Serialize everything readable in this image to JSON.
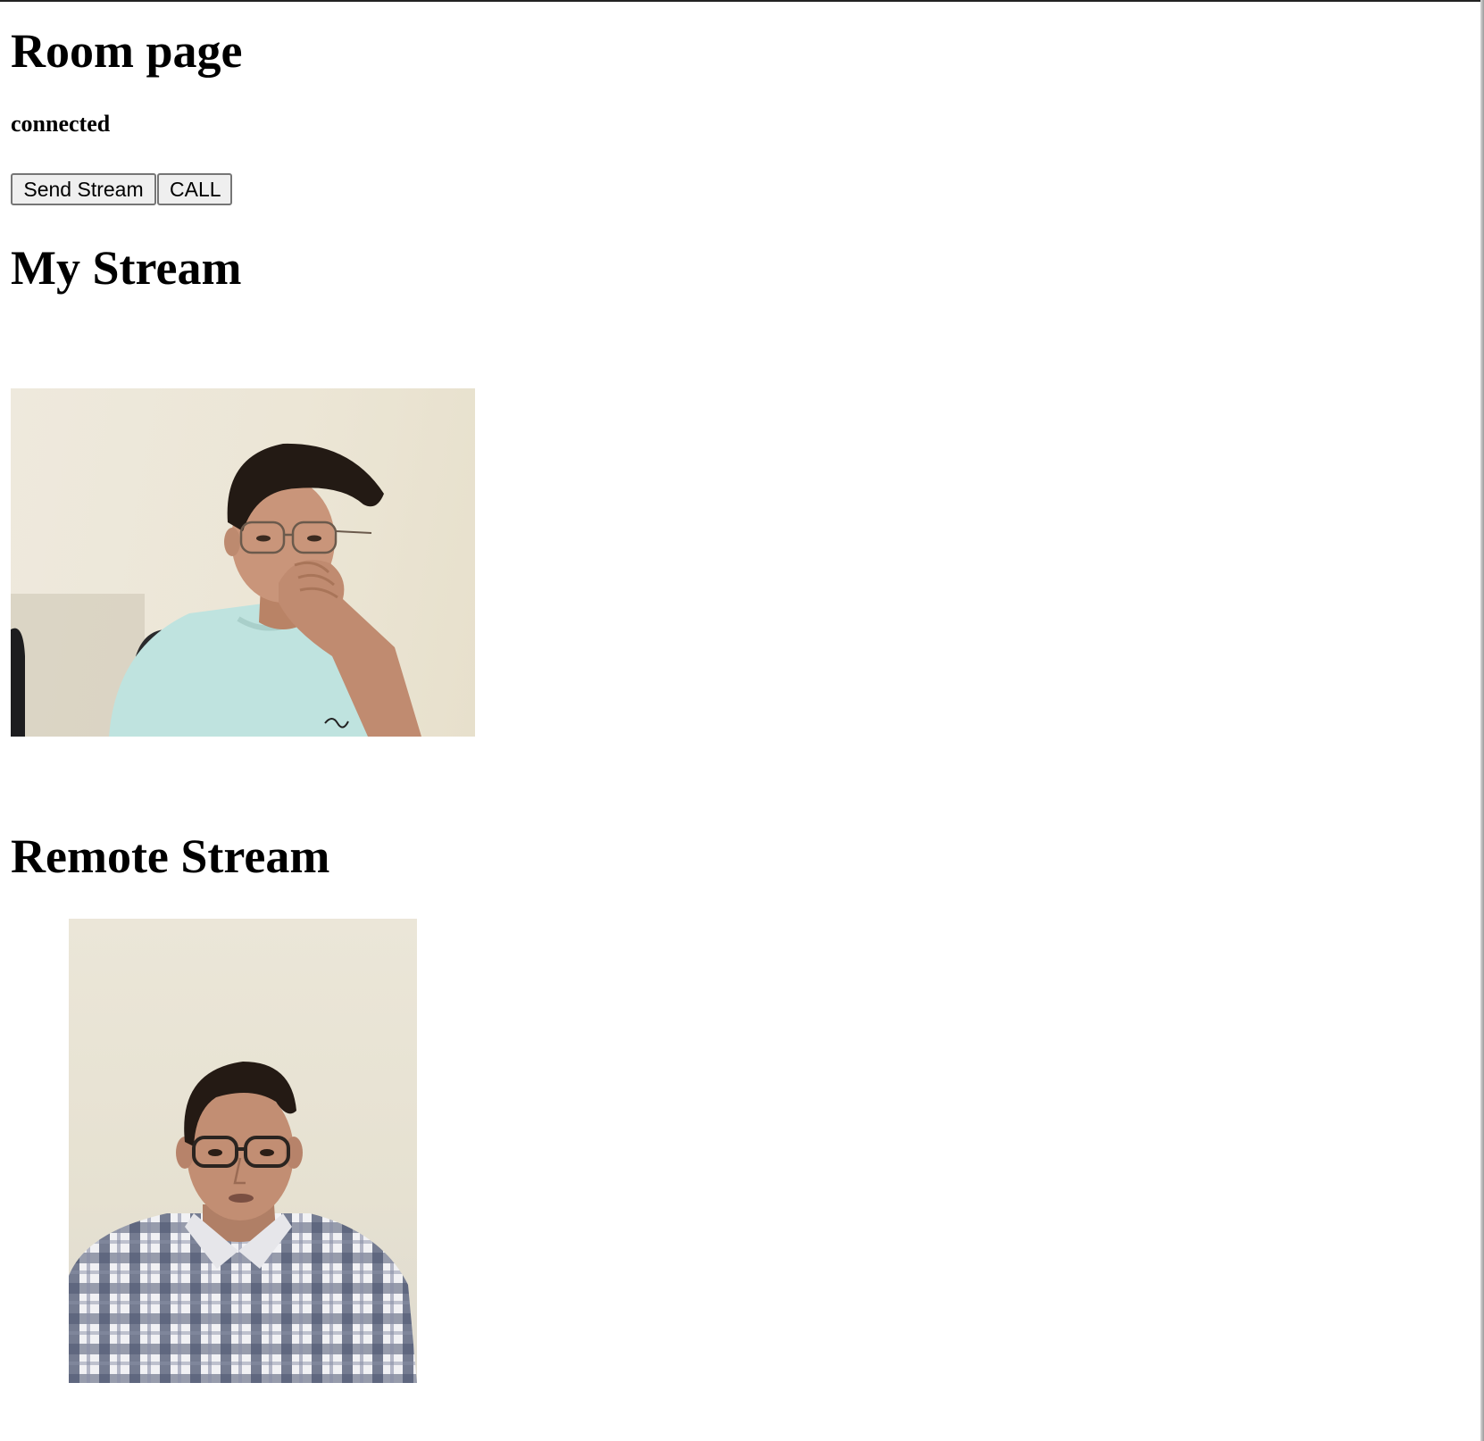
{
  "page": {
    "title": "Room page",
    "status": "connected"
  },
  "controls": {
    "send_stream_label": "Send Stream",
    "call_label": "CALL"
  },
  "sections": {
    "my_stream_heading": "My Stream",
    "remote_stream_heading": "Remote Stream"
  },
  "colors": {
    "shirt_my": "#bfe3df",
    "skin": "#c9957a",
    "hair": "#231a14",
    "wall": "#ece6d6"
  }
}
